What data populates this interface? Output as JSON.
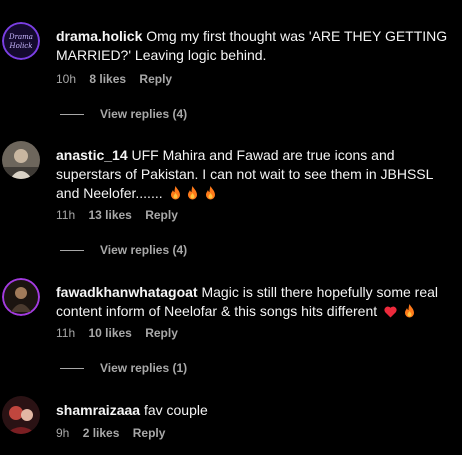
{
  "comments": [
    {
      "username": "drama.holick",
      "avatar_text": "Drama Holick",
      "text": "Omg my first thought was 'ARE THEY GETTING MARRIED?' Leaving logic behind.",
      "time": "10h",
      "likes": "8 likes",
      "reply": "Reply",
      "view_replies": "View replies (4)"
    },
    {
      "username": "anastic_14",
      "text": "UFF Mahira and Fawad are true icons and superstars of Pakistan. I can not wait to see them in JBHSSL and Neelofer.......",
      "emojis": [
        "fire-icon",
        "fire-icon",
        "fire-icon"
      ],
      "time": "11h",
      "likes": "13 likes",
      "reply": "Reply",
      "view_replies": "View replies (4)"
    },
    {
      "username": "fawadkhanwhatagoat",
      "text": "Magic is still there hopefully some real content inform of Neelofar & this songs hits different",
      "emojis": [
        "red-heart-icon",
        "fire-icon"
      ],
      "time": "11h",
      "likes": "10 likes",
      "reply": "Reply",
      "view_replies": "View replies (1)"
    },
    {
      "username": "shamraizaaa",
      "text": "fav couple",
      "time": "9h",
      "likes": "2 likes",
      "reply": "Reply"
    }
  ],
  "colors": {
    "background": "#000000",
    "primary_text": "#f5f5f5",
    "secondary_text": "#a8a8a8",
    "fire": "#ff7a1a",
    "heart": "#ed2a3c",
    "avatar_ring": "#8a2be2"
  }
}
